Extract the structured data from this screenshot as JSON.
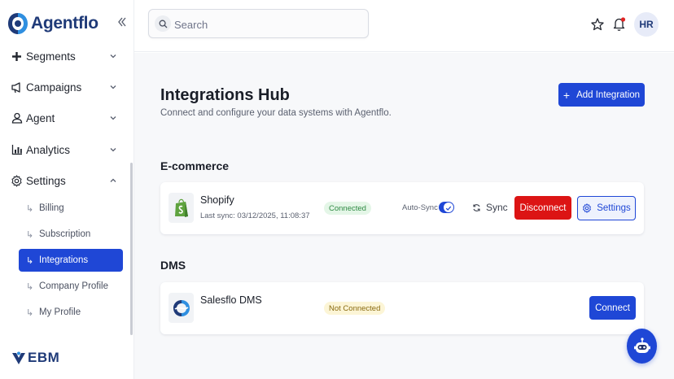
{
  "brand": {
    "name": "Agentflo",
    "footer_logo": "EBM"
  },
  "sidebar": {
    "collapse_icon": "double-chevron-left-icon",
    "items": [
      {
        "label": "Segments",
        "icon": "plus-icon",
        "expanded": false
      },
      {
        "label": "Campaigns",
        "icon": "megaphone-icon",
        "expanded": false
      },
      {
        "label": "Agent",
        "icon": "user-icon",
        "expanded": false
      },
      {
        "label": "Analytics",
        "icon": "bar-chart-icon",
        "expanded": false
      },
      {
        "label": "Settings",
        "icon": "gear-icon",
        "expanded": true
      }
    ],
    "sub_items": [
      {
        "label": "Billing",
        "active": false
      },
      {
        "label": "Subscription",
        "active": false
      },
      {
        "label": "Integrations",
        "active": true
      },
      {
        "label": "Company Profile",
        "active": false
      },
      {
        "label": "My Profile",
        "active": false
      }
    ]
  },
  "header": {
    "search_placeholder": "Search",
    "avatar_initials": "HR"
  },
  "main": {
    "title": "Integrations Hub",
    "subtitle": "Connect and configure your data systems with Agentflo.",
    "add_button": "Add Integration",
    "sections": [
      {
        "title": "E-commerce",
        "integrations": [
          {
            "name": "Shopify",
            "last_sync": "Last sync: 03/12/2025, 11:08:37",
            "status": "Connected",
            "auto_sync_label": "Auto-Sync",
            "auto_sync_on": true,
            "sync_label": "Sync",
            "disconnect_label": "Disconnect",
            "settings_label": "Settings"
          }
        ]
      },
      {
        "title": "DMS",
        "integrations": [
          {
            "name": "Salesflo DMS",
            "status": "Not Connected",
            "connect_label": "Connect"
          }
        ]
      }
    ]
  },
  "colors": {
    "primary": "#1f47d6",
    "danger": "#dc1414",
    "brand_navy": "#1f3a78",
    "connected_bg": "#e4f6e7",
    "not_connected_bg": "#fcf5d6"
  }
}
